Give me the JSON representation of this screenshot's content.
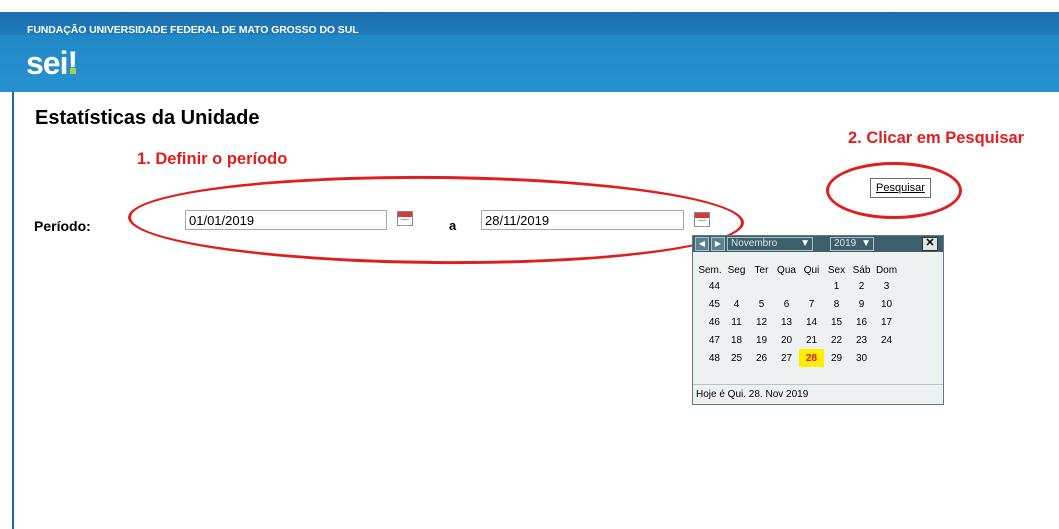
{
  "header": {
    "org_name": "FUNDAÇÃO UNIVERSIDADE FEDERAL DE MATO GROSSO DO SUL",
    "logo_text": "sei",
    "logo_bang": "!",
    "bar_color": "#2188c7"
  },
  "page": {
    "title": "Estatísticas da Unidade"
  },
  "annotations": {
    "step1": "1. Definir o período",
    "step2": "2. Clicar em Pesquisar",
    "color": "#e01e1e"
  },
  "form": {
    "period_label": "Período:",
    "start_date": "01/01/2019",
    "separator": "a",
    "end_date": "28/11/2019",
    "search_button": "Pesquisar",
    "calendar_icon": "calendar-icon"
  },
  "calendar": {
    "prev_icon": "◀",
    "next_icon": "▶",
    "month": "Novembro",
    "year": "2019",
    "close_label": "✕",
    "headers": [
      "Sem.",
      "Seg",
      "Ter",
      "Qua",
      "Qui",
      "Sex",
      "Sáb",
      "Dom"
    ],
    "weeks": [
      [
        "44",
        "",
        "",
        "",
        "",
        "1",
        "2",
        "3"
      ],
      [
        "45",
        "4",
        "5",
        "6",
        "7",
        "8",
        "9",
        "10"
      ],
      [
        "46",
        "11",
        "12",
        "13",
        "14",
        "15",
        "16",
        "17"
      ],
      [
        "47",
        "18",
        "19",
        "20",
        "21",
        "22",
        "23",
        "24"
      ],
      [
        "48",
        "25",
        "26",
        "27",
        "28",
        "29",
        "30",
        ""
      ]
    ],
    "today_day": "28",
    "today_text": "Hoje é Qui. 28. Nov 2019",
    "today_color": "#ffee00"
  }
}
